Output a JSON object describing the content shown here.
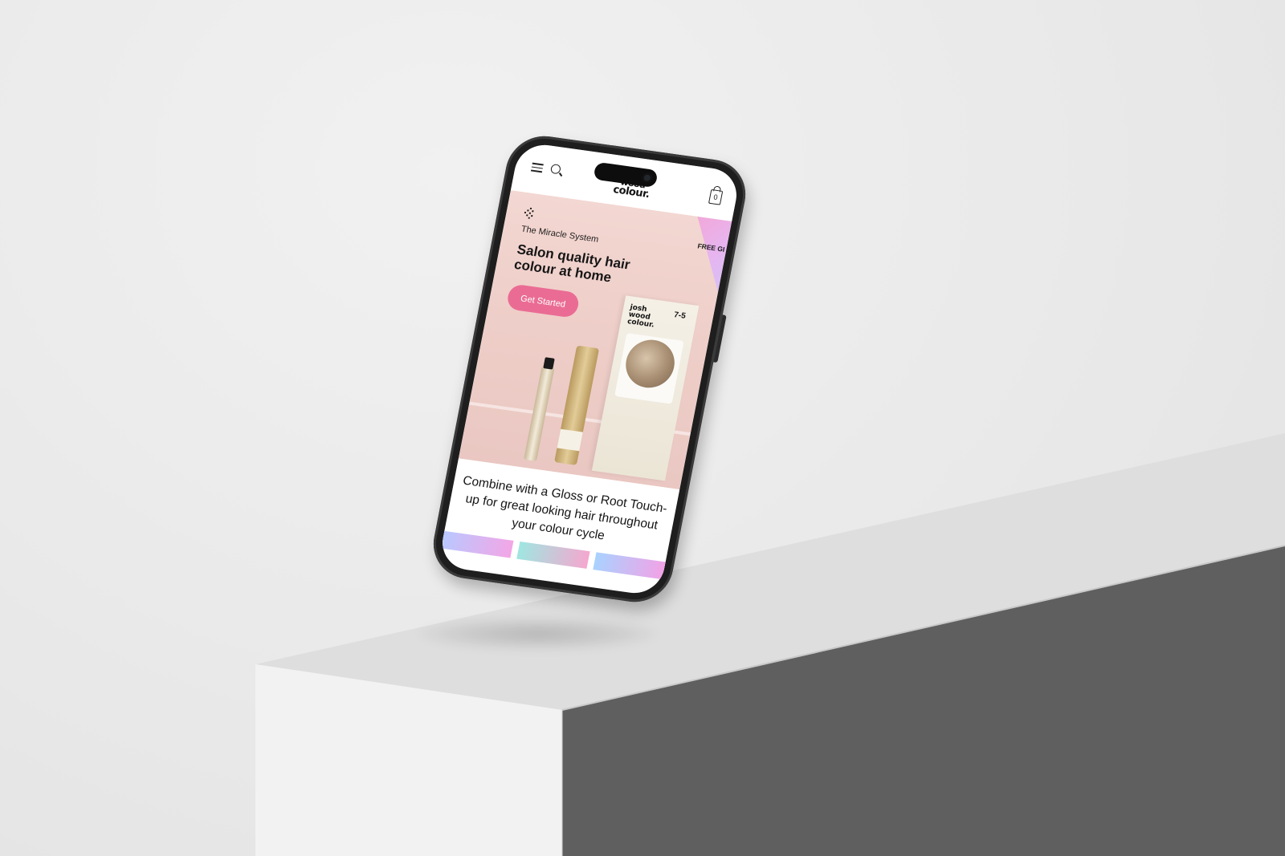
{
  "scene": {
    "wall_color": "#e9e9e9",
    "pedestal_top_color": "#dcdcdc",
    "pedestal_front_color": "#f2f2f2",
    "pedestal_side_color": "#5d5d5d"
  },
  "header": {
    "menu_icon": "hamburger-icon",
    "search_icon": "search-icon",
    "logo_top": "wood",
    "logo_bottom": "colour.",
    "bag_icon": "shopping-bag-icon",
    "bag_count": "0"
  },
  "hero": {
    "eyebrow": "The Miracle System",
    "title": "Salon quality hair colour at home",
    "cta_label": "Get Started",
    "cta_color": "#ea6c94",
    "promo_text": "FREE GI SHO NO",
    "product_box_brand": "josh wood colour.",
    "product_box_shade": "7-5"
  },
  "content": {
    "body": "Combine with a Gloss or Root Touch-up for great looking hair throughout your colour cycle"
  }
}
